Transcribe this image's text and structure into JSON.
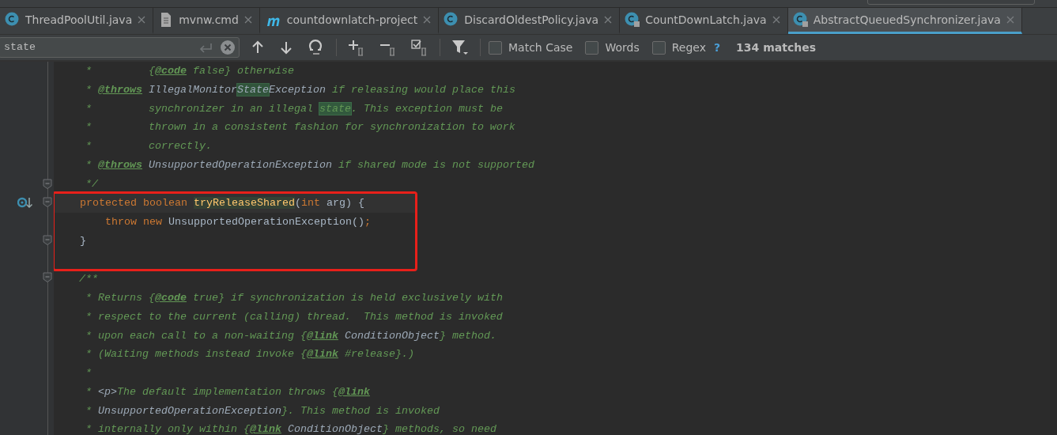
{
  "tabs": [
    {
      "label": "ThreadPoolUtil.java",
      "kind": "class",
      "locked": false,
      "selected": false
    },
    {
      "label": "mvnw.cmd",
      "kind": "file",
      "locked": false,
      "selected": false
    },
    {
      "label": "countdownlatch-project",
      "kind": "maven",
      "locked": false,
      "selected": false
    },
    {
      "label": "DiscardOldestPolicy.java",
      "kind": "class",
      "locked": false,
      "selected": false
    },
    {
      "label": "CountDownLatch.java",
      "kind": "class",
      "locked": true,
      "selected": false
    },
    {
      "label": "AbstractQueuedSynchronizer.java",
      "kind": "class",
      "locked": true,
      "selected": true
    }
  ],
  "find_bar": {
    "value": "state",
    "options": [
      {
        "label": "Match Case",
        "checked": false
      },
      {
        "label": "Words",
        "checked": false
      },
      {
        "label": "Regex",
        "checked": false
      }
    ],
    "help": "?",
    "matches": "134 matches"
  },
  "editor": {
    "lines": [
      {
        "tokens": [
          {
            "text": "     *         {",
            "kind": "comment"
          },
          {
            "text": "@code",
            "kind": "tag"
          },
          {
            "text": " false} otherwise",
            "kind": "comment"
          }
        ]
      },
      {
        "tokens": [
          {
            "text": "     * ",
            "kind": "comment"
          },
          {
            "text": "@throws",
            "kind": "tag"
          },
          {
            "text": " IllegalMonitor",
            "kind": "ref"
          },
          {
            "text": "State",
            "kind": "ref",
            "match": true
          },
          {
            "text": "Exception",
            "kind": "ref"
          },
          {
            "text": " if releasing would place this",
            "kind": "comment"
          }
        ]
      },
      {
        "tokens": [
          {
            "text": "     *         synchronizer in an illegal ",
            "kind": "comment"
          },
          {
            "text": "state",
            "kind": "comment",
            "match": true
          },
          {
            "text": ". This exception must be",
            "kind": "comment"
          }
        ]
      },
      {
        "tokens": [
          {
            "text": "     *         thrown in a consistent fashion for synchronization to work",
            "kind": "comment"
          }
        ]
      },
      {
        "tokens": [
          {
            "text": "     *         correctly.",
            "kind": "comment"
          }
        ]
      },
      {
        "tokens": [
          {
            "text": "     * ",
            "kind": "comment"
          },
          {
            "text": "@throws",
            "kind": "tag"
          },
          {
            "text": " UnsupportedOperationException",
            "kind": "ref"
          },
          {
            "text": " if shared mode is not supported",
            "kind": "comment"
          }
        ]
      },
      {
        "fold": true,
        "tokens": [
          {
            "text": "     */",
            "kind": "comment"
          }
        ]
      },
      {
        "fold": true,
        "highlighted": true,
        "current": true,
        "overrides": true,
        "tokens": [
          {
            "text": "    protected boolean ",
            "kind": "keyword"
          },
          {
            "text": "tryReleaseShared",
            "kind": "method"
          },
          {
            "text": "(",
            "kind": "plain"
          },
          {
            "text": "int",
            "kind": "keyword"
          },
          {
            "text": " arg) {",
            "kind": "plain"
          }
        ]
      },
      {
        "highlighted": true,
        "tokens": [
          {
            "text": "        throw new ",
            "kind": "keyword"
          },
          {
            "text": "UnsupportedOperationException()",
            "kind": "plain"
          },
          {
            "text": ";",
            "kind": "keyword"
          }
        ]
      },
      {
        "fold": true,
        "highlighted": true,
        "tokens": [
          {
            "text": "    }",
            "kind": "plain"
          }
        ]
      },
      {
        "highlighted": true
      },
      {
        "fold": true,
        "tokens": [
          {
            "text": "    /**",
            "kind": "comment"
          }
        ]
      },
      {
        "tokens": [
          {
            "text": "     * Returns {",
            "kind": "comment"
          },
          {
            "text": "@code",
            "kind": "tag"
          },
          {
            "text": " true} if synchronization is held exclusively with",
            "kind": "comment"
          }
        ]
      },
      {
        "tokens": [
          {
            "text": "     * respect to the current (calling) thread.  This method is invoked",
            "kind": "comment"
          }
        ]
      },
      {
        "tokens": [
          {
            "text": "     * upon each call to a non-waiting {",
            "kind": "comment"
          },
          {
            "text": "@link",
            "kind": "tag"
          },
          {
            "text": " ConditionObject",
            "kind": "ref"
          },
          {
            "text": "} method.",
            "kind": "comment"
          }
        ]
      },
      {
        "tokens": [
          {
            "text": "     * (Waiting methods instead invoke {",
            "kind": "comment"
          },
          {
            "text": "@link",
            "kind": "tag"
          },
          {
            "text": " #release}.)",
            "kind": "comment"
          }
        ]
      },
      {
        "tokens": [
          {
            "text": "     *",
            "kind": "comment"
          }
        ]
      },
      {
        "tokens": [
          {
            "text": "     * ",
            "kind": "comment"
          },
          {
            "text": "<p>",
            "kind": "ref"
          },
          {
            "text": "The default implementation throws {",
            "kind": "comment"
          },
          {
            "text": "@link",
            "kind": "tag"
          }
        ]
      },
      {
        "tokens": [
          {
            "text": "     * ",
            "kind": "comment"
          },
          {
            "text": "UnsupportedOperationException",
            "kind": "ref"
          },
          {
            "text": "}. This method is invoked",
            "kind": "comment"
          }
        ]
      },
      {
        "tokens": [
          {
            "text": "     * internally only within {",
            "kind": "comment"
          },
          {
            "text": "@link",
            "kind": "tag"
          },
          {
            "text": " ConditionObject",
            "kind": "ref"
          },
          {
            "text": "} methods, so need",
            "kind": "comment"
          }
        ]
      }
    ]
  }
}
